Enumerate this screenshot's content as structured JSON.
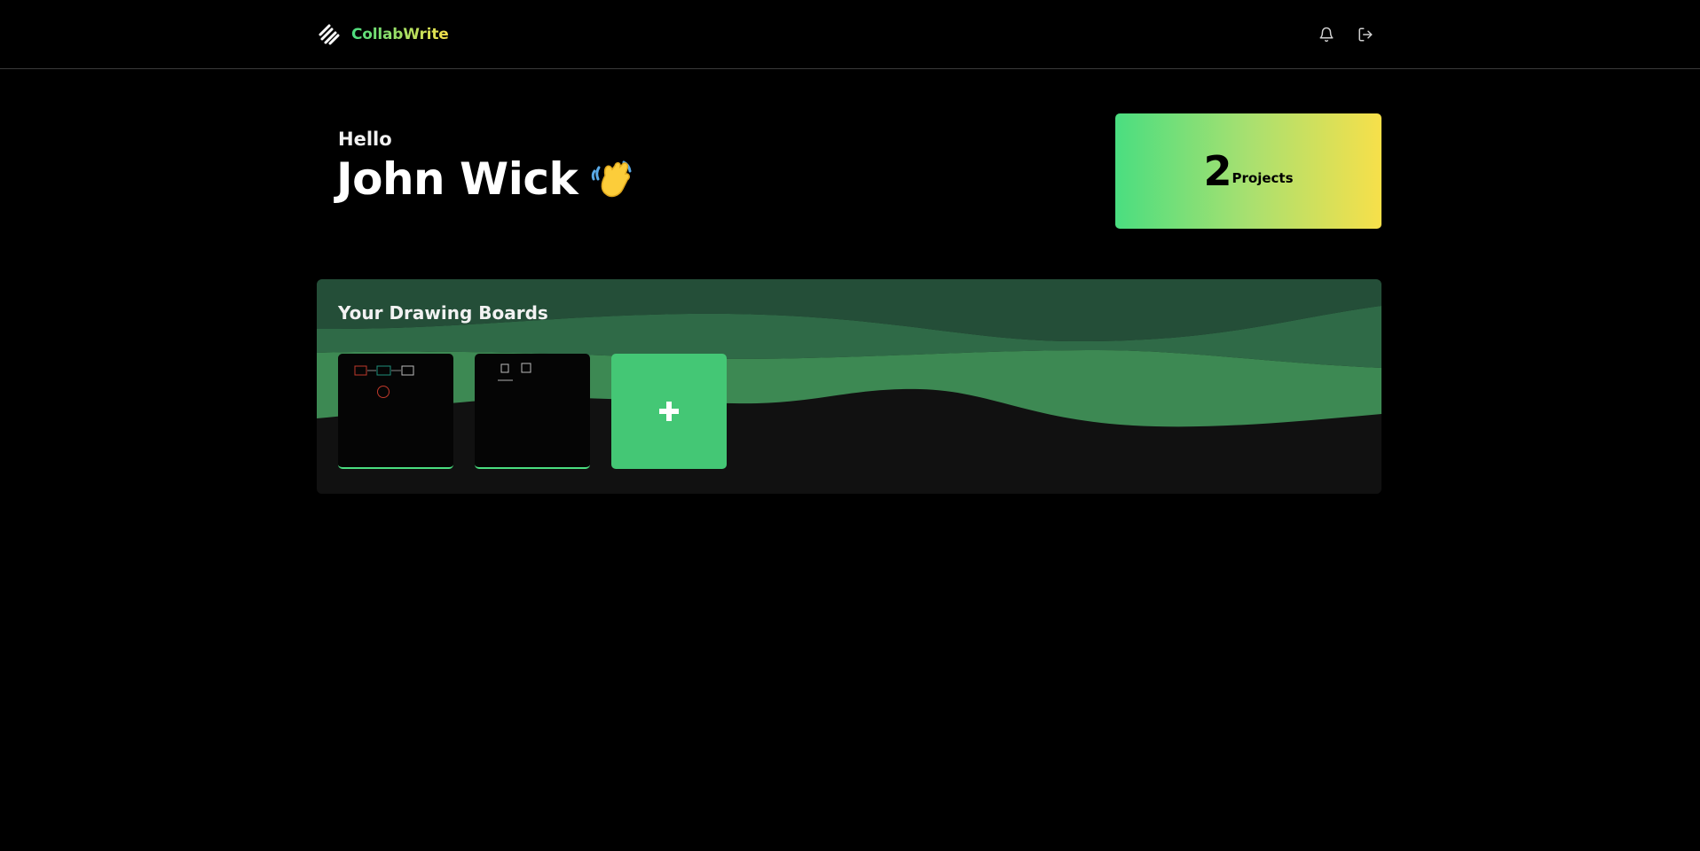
{
  "app": {
    "name": "CollabWrite",
    "logo_icon": "handshake-logo-icon"
  },
  "header": {
    "icons": [
      "bell-icon",
      "logout-icon"
    ]
  },
  "greeting": {
    "hello": "Hello",
    "user_name": "John Wick",
    "emoji_icon": "waving-hand-icon"
  },
  "stats": {
    "count": "2",
    "label": "Projects"
  },
  "boards": {
    "title": "Your Drawing Boards",
    "items": [
      {
        "thumbnail": "diagram-shapes-thumbnail"
      },
      {
        "thumbnail": "squares-thumbnail"
      }
    ],
    "add_icon": "plus-icon"
  },
  "colors": {
    "background": "#000000",
    "accent_green": "#4ade80",
    "accent_yellow": "#f7e04a",
    "add_tile": "#44c775",
    "wave_dark": "#244e38",
    "wave_mid": "#2f6a47",
    "wave_light": "#3d8953"
  }
}
